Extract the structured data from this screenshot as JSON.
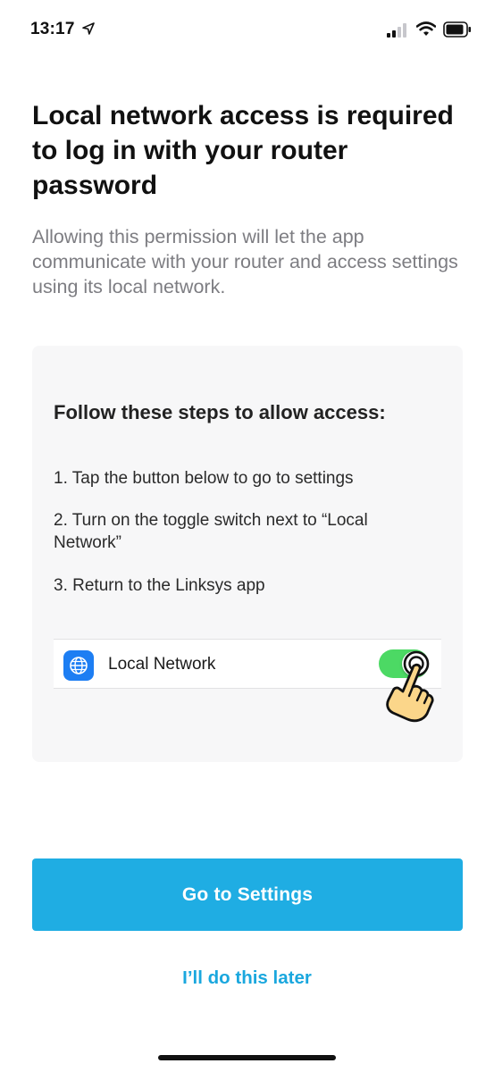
{
  "status_bar": {
    "time": "13:17",
    "icons": [
      "location-arrow-icon",
      "cellular-signal-icon",
      "wifi-icon",
      "battery-icon"
    ]
  },
  "title": "Local network access is required to log in with your router password",
  "subtitle": "Allowing this permission will let the app communicate with your router and access settings using its local network.",
  "card": {
    "heading": "Follow these steps to allow access:",
    "steps": [
      "1. Tap the button below to go to settings",
      "2. Turn on the toggle switch next to “Local Network”",
      "3. Return to the Linksys app"
    ],
    "setting_row": {
      "icon": "globe-icon",
      "label": "Local Network",
      "toggle_on": true
    },
    "hint_icon": "tap-hand-icon"
  },
  "buttons": {
    "primary_label": "Go to Settings",
    "secondary_label": "I’ll do this later"
  },
  "colors": {
    "accent": "#1fade3",
    "link": "#1aa7de",
    "toggle_on": "#4cd964",
    "card_bg": "#f7f7f8",
    "subtitle": "#7d7d82"
  }
}
